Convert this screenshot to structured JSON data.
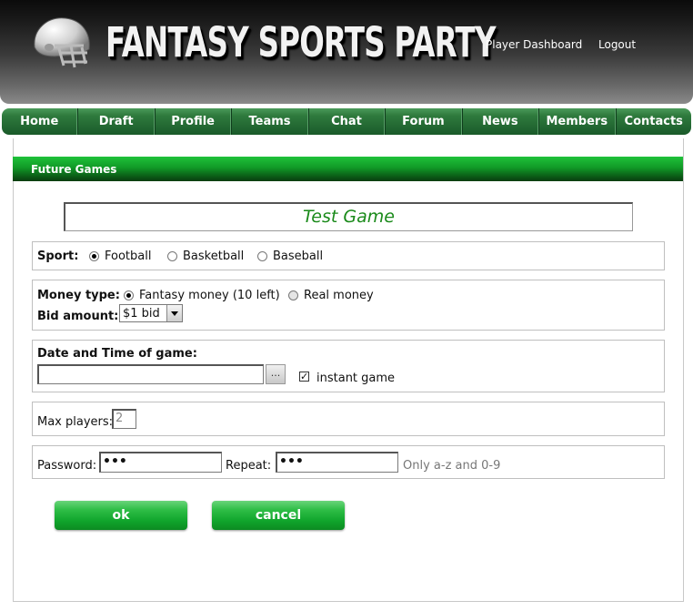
{
  "header": {
    "site_title": "FANTASY SPORTS PARTY",
    "links": {
      "dashboard": "Player Dashboard",
      "logout": "Logout"
    }
  },
  "nav": {
    "items": [
      {
        "label": "Home"
      },
      {
        "label": "Draft"
      },
      {
        "label": "Profile"
      },
      {
        "label": "Teams"
      },
      {
        "label": "Chat"
      },
      {
        "label": "Forum"
      },
      {
        "label": "News"
      },
      {
        "label": "Members"
      },
      {
        "label": "Contacts"
      }
    ]
  },
  "section": {
    "title": "Future Games"
  },
  "game": {
    "name": "Test Game"
  },
  "sport": {
    "label": "Sport:",
    "options": [
      {
        "label": "Football",
        "checked": true
      },
      {
        "label": "Basketball",
        "checked": false
      },
      {
        "label": "Baseball",
        "checked": false
      }
    ]
  },
  "money": {
    "label": "Money type:",
    "options": [
      {
        "label": "Fantasy money (10 left)",
        "checked": true
      },
      {
        "label": "Real money",
        "checked": false
      }
    ],
    "bid_label": "Bid amount:",
    "bid_value": "$1 bid"
  },
  "datetime": {
    "label": "Date and Time of game:",
    "value": "",
    "browse_label": "...",
    "instant_label": "instant game",
    "instant_checked": true
  },
  "max_players": {
    "label": "Max players:",
    "value": "2"
  },
  "password": {
    "label": "Password:",
    "value": "•••",
    "repeat_label": "Repeat:",
    "repeat_value": "•••",
    "hint": "Only a-z and 0-9"
  },
  "buttons": {
    "ok": "ok",
    "cancel": "cancel"
  },
  "colors": {
    "nav_green": "#2f7a3d",
    "bar_green": "#119a27",
    "button_green": "#10a52c",
    "title_green": "#1a8a1a"
  }
}
